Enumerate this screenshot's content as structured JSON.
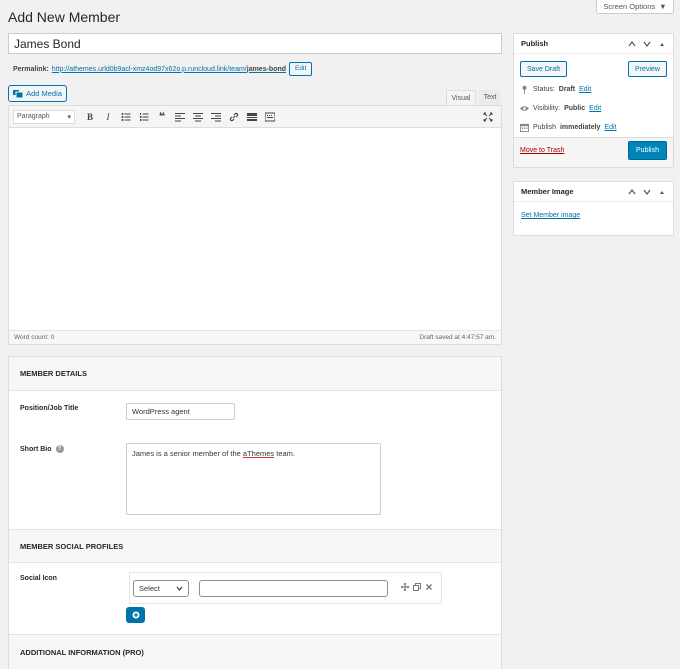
{
  "page": {
    "title": "Add New Member"
  },
  "screen_options": {
    "label": "Screen Options"
  },
  "post": {
    "title": "James Bond"
  },
  "permalink": {
    "label": "Permalink:",
    "url_prefix": "http://athemes.urld0b9acl-xmz4od97x62o.p.runcloud.link/team/",
    "slug": "james-bond",
    "edit_label": "Edit"
  },
  "editor": {
    "add_media_label": "Add Media",
    "tabs": {
      "visual": "Visual",
      "text": "Text"
    },
    "format_select": "Paragraph",
    "word_count": "Word count: 0",
    "draft_saved": "Draft saved at 4:47:57 am."
  },
  "publish_box": {
    "title": "Publish",
    "save_draft": "Save Draft",
    "preview": "Preview",
    "status_label": "Status:",
    "status_value": "Draft",
    "visibility_label": "Visibility:",
    "visibility_value": "Public",
    "publish_label": "Publish",
    "publish_value": "immediately",
    "edit_link": "Edit",
    "trash": "Move to Trash",
    "publish_button": "Publish"
  },
  "member_image": {
    "title": "Member Image",
    "set_link": "Set Member image"
  },
  "member_details": {
    "title": "MEMBER DETAILS",
    "position_label": "Position/Job Title",
    "position_value": "WordPress agent",
    "bio_label": "Short Bio",
    "help_icon": "?",
    "bio_before": "James is a senior member of the ",
    "bio_word": "aThemes",
    "bio_after": " team."
  },
  "social": {
    "title": "MEMBER SOCIAL PROFILES",
    "icon_label": "Social Icon",
    "select_value": "Select",
    "url_value": ""
  },
  "additional": {
    "title": "ADDITIONAL INFORMATION (PRO)"
  },
  "colors": {
    "accent": "#0073aa",
    "primary_button": "#0085ba",
    "trash": "#a00"
  }
}
